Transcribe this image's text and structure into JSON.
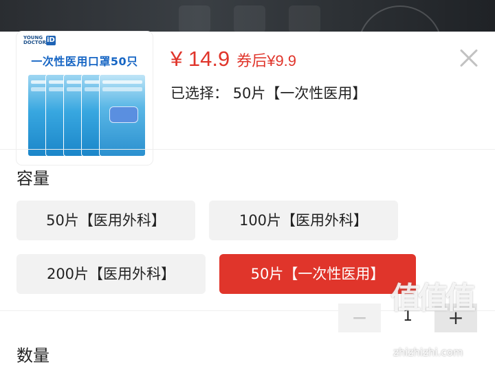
{
  "product": {
    "brand_text": "YOUNG DOCTOR",
    "brand_mark": "iD",
    "image_title": "一次性医用口罩50只",
    "price": "¥ 14.9",
    "coupon_price": "券后¥9.9",
    "selected_label": "已选择：",
    "selected_value": "50片【一次性医用】"
  },
  "capacity": {
    "title": "容量",
    "options": [
      {
        "label": "50片【医用外科】",
        "selected": false
      },
      {
        "label": "100片【医用外科】",
        "selected": false
      },
      {
        "label": "200片【医用外科】",
        "selected": false
      },
      {
        "label": "50片【一次性医用】",
        "selected": true
      }
    ]
  },
  "quantity": {
    "title": "数量",
    "minus": "−",
    "value": "1",
    "plus": "+"
  },
  "watermark": {
    "glyphs": "值值值",
    "site": "zhizhizhi.com"
  },
  "colors": {
    "accent": "#e0352b",
    "option_bg": "#f2f2f2",
    "brand_blue": "#1766c4"
  },
  "icons": {
    "close": "close-icon"
  }
}
